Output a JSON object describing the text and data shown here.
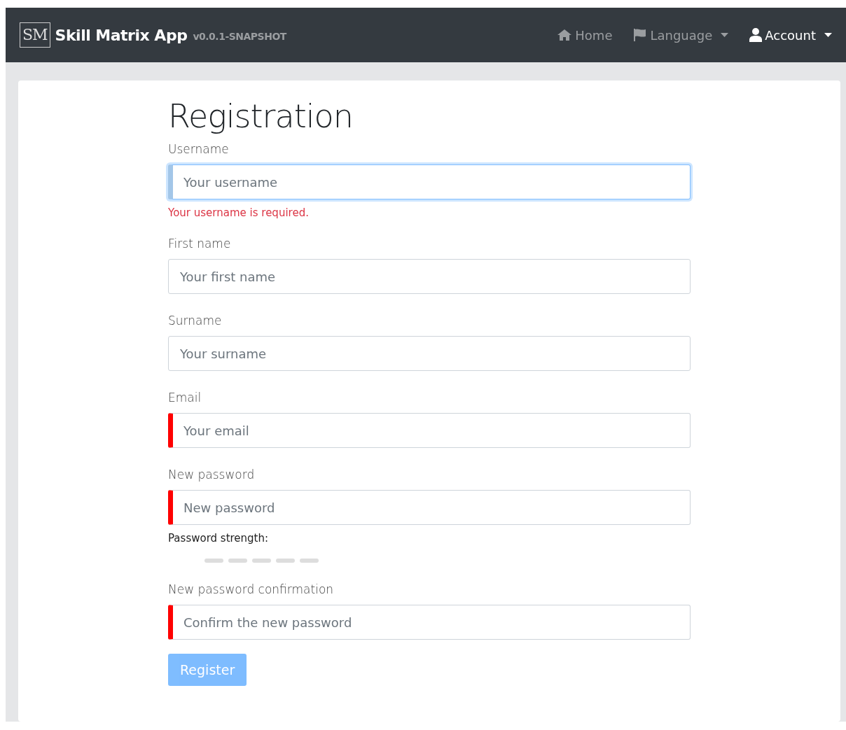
{
  "navbar": {
    "logo": "SM",
    "brand": "Skill Matrix App",
    "version": "v0.0.1-SNAPSHOT",
    "items": [
      {
        "label": "Home",
        "dropdown": false,
        "selected": false
      },
      {
        "label": "Language",
        "dropdown": true,
        "selected": false
      },
      {
        "label": "Account",
        "dropdown": true,
        "selected": true
      }
    ]
  },
  "title": "Registration",
  "fields": [
    {
      "label": "Username",
      "placeholder": "Your username",
      "focused": true,
      "invalid": false,
      "error": "Your username is required."
    },
    {
      "label": "First name",
      "placeholder": "Your first name",
      "focused": false,
      "invalid": false
    },
    {
      "label": "Surname",
      "placeholder": "Your surname",
      "focused": false,
      "invalid": false
    },
    {
      "label": "Email",
      "placeholder": "Your email",
      "focused": false,
      "invalid": true
    },
    {
      "label": "New password",
      "placeholder": "New password",
      "focused": false,
      "invalid": true,
      "strength": {
        "label": "Password strength:"
      }
    },
    {
      "label": "New password confirmation",
      "placeholder": "Confirm the new password",
      "focused": false,
      "invalid": true
    }
  ],
  "submit": {
    "label": "Register",
    "disabled": true
  }
}
